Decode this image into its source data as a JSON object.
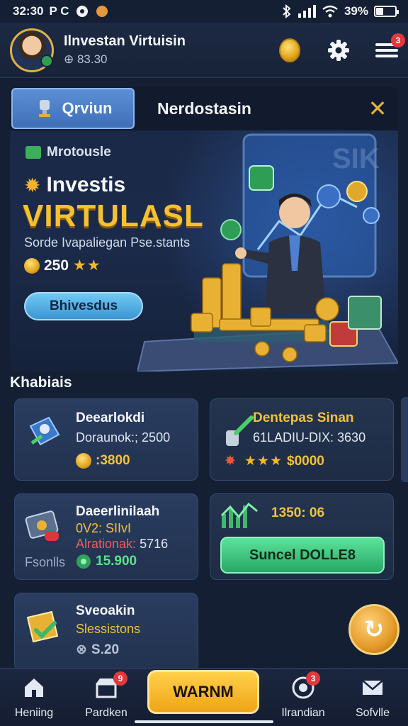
{
  "status_bar": {
    "time": "32:30",
    "left_glyphs": "P C",
    "battery_text": "39%",
    "battery_level": 0.39
  },
  "header": {
    "user_name": "Ilnvestan Virtuisin",
    "balance": "⊕ 83.30",
    "notification_count": "3",
    "icons": [
      "gold-coin-icon",
      "gear-icon",
      "menu-icon"
    ]
  },
  "hero": {
    "tab_active": "Qrviun",
    "tab_other": "Nerdostasin",
    "category": "Mrotousle",
    "kicker": "Investis",
    "title": "VIRTULASL",
    "subtitle": "Sorde Ivapaliegan Pse.stants",
    "reward_value": "250",
    "reward_stars": "★★",
    "cta_label": "Bhivesdus",
    "illustration_badge_text": "SIK"
  },
  "section_title": "Khabiais",
  "cards": [
    {
      "icon": "map-pin-icon",
      "title": "Deearlokdi",
      "line": "Doraunok:; 2500",
      "value": ":3800",
      "value_color": "#f2c23a"
    },
    {
      "icon": "wrench-icon",
      "title": "Dentepas Sinan",
      "line": "61LADIU-DIX: 3630",
      "stars": "★★★",
      "value": "$0000",
      "title_color": "#f2c23a"
    },
    {
      "icon": "wallet-icon",
      "title": "Daeerlinilaah",
      "line_a": "0V2: SIIvI",
      "line_b_label": "Alrationak:",
      "line_b_value": "5716",
      "footer_label": "Fsonlls",
      "value": "15.900",
      "value_color": "#5fe08c"
    },
    {
      "icon": "bar-chart-icon",
      "headline": "1350: 06",
      "button_label": "Suncel DOLLE8"
    },
    {
      "icon": "folder-check-icon",
      "title": "Sveoakin",
      "line": "Slessistons",
      "value": "S.20"
    }
  ],
  "bottom_nav": {
    "items": [
      {
        "label": "Heniing",
        "icon": "home-icon"
      },
      {
        "label": "Pardken",
        "icon": "store-icon",
        "badge": "9"
      },
      {
        "label": "Ilrandian",
        "icon": "target-icon",
        "badge": "3"
      },
      {
        "label": "Sofvlle",
        "icon": "mail-icon"
      }
    ],
    "center_label": "WARNM"
  },
  "colors": {
    "background": "#141f33",
    "accent_gold": "#f4c131",
    "accent_green": "#27a866",
    "accent_blue": "#3f6fb8",
    "badge_red": "#e2383b"
  }
}
